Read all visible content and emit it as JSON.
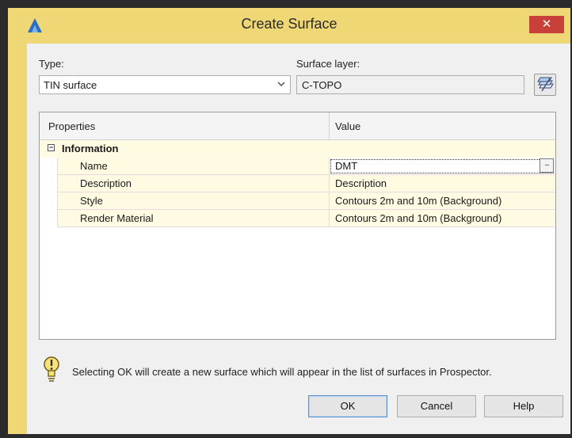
{
  "window": {
    "title": "Create Surface",
    "close_label": "✕"
  },
  "form": {
    "type_label": "Type:",
    "type_value": "TIN surface",
    "surface_layer_label": "Surface layer:",
    "surface_layer_value": "C-TOPO"
  },
  "grid": {
    "headers": [
      "Properties",
      "Value"
    ],
    "category": "Information",
    "rows": [
      {
        "name": "Name",
        "value": "DMT"
      },
      {
        "name": "Description",
        "value": "Description"
      },
      {
        "name": "Style",
        "value": "Contours 2m and 10m (Background)"
      },
      {
        "name": "Render Material",
        "value": "Contours 2m and 10m (Background)"
      }
    ],
    "ellipsis_label": "..."
  },
  "info_text": "Selecting OK will create a new surface which will appear in the list of surfaces in Prospector.",
  "buttons": {
    "ok": "OK",
    "cancel": "Cancel",
    "help": "Help"
  },
  "colors": {
    "title_bar": "#efd776",
    "close_button": "#c7403a",
    "grid_row": "#fffbe3"
  }
}
